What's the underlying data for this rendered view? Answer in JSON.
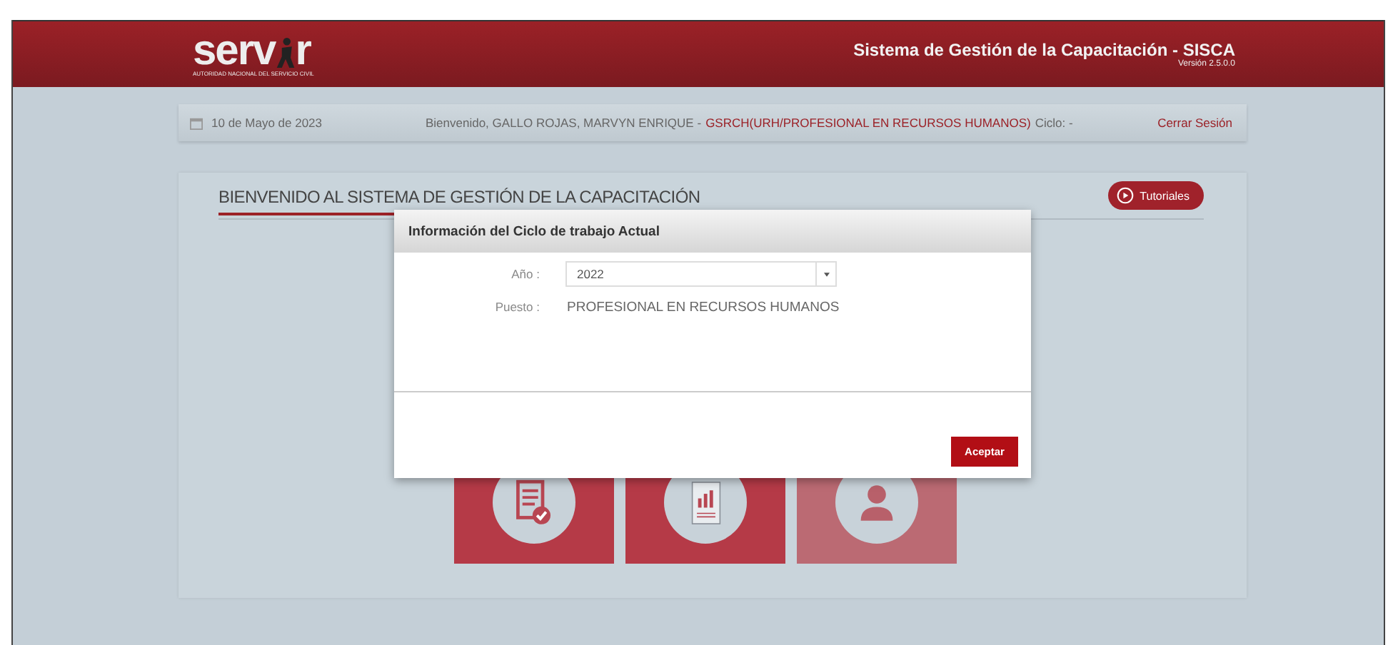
{
  "header": {
    "logo": {
      "part_1": "serv",
      "part_2": "r",
      "subtitle": "AUTORIDAD NACIONAL DEL SERVICIO CIVIL"
    },
    "title": "Sistema de Gestión de la Capacitación - SISCA",
    "version": "Versión 2.5.0.0"
  },
  "info_bar": {
    "date": "10 de Mayo de 2023",
    "welcome": "Bienvenido,  GALLO ROJAS, MARVYN ENRIQUE  - ",
    "role": "GSRCH(URH/PROFESIONAL EN RECURSOS HUMANOS)",
    "cycle": "Ciclo: -",
    "logout": "Cerrar Sesión"
  },
  "main": {
    "title": "BIENVENIDO AL SISTEMA DE GESTIÓN DE LA CAPACITACIÓN",
    "tutorials_button": "Tutoriales",
    "tiles": [
      {
        "kind": "checklist",
        "disabled": false
      },
      {
        "kind": "report",
        "disabled": false
      },
      {
        "kind": "support",
        "disabled": true
      }
    ]
  },
  "modal": {
    "title": "Información del Ciclo de trabajo Actual",
    "year_label": "Año :",
    "year_value": "2022",
    "position_label": "Puesto :",
    "position_value": "PROFESIONAL EN RECURSOS HUMANOS",
    "accept_button": "Aceptar"
  }
}
